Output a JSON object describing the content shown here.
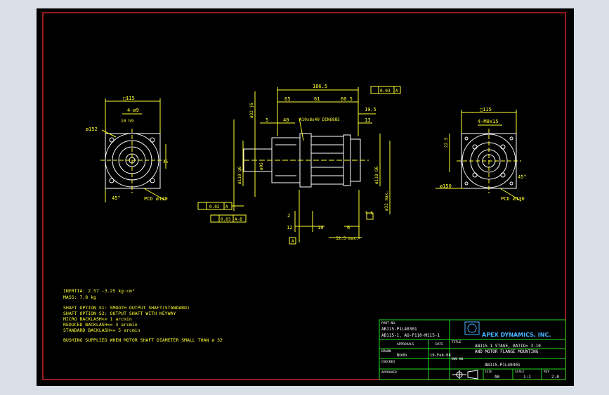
{
  "notes": {
    "inertia": "INERTIA:   2.57 -3.25 kg·cm²",
    "mass": "MASS: 7.8 kg",
    "shaft_s1": "SHAFT OPTION S1: SMOOTH OUTPUT SHAFT(STANDARD)",
    "shaft_s2": "SHAFT OPTION S2: OUTPUT SHAFT WITH KEYWAY",
    "micro": "MICRO BACKLASH<= 1 arcmin",
    "reduced": "REDUCED BACKLASH<= 3 arcmin",
    "standard": "STANDARD BACKLASH<= 5 arcmin",
    "bushing": "BUSHING SUPPLIED WHEN MOTOR SHAFT DIAMETER SMALL THAN ø 32"
  },
  "left_view": {
    "square": "□115",
    "holes": "4-ø9",
    "fit": "10 h9",
    "pcd": "PCD ø130",
    "dia": "ø152",
    "angle": "45°",
    "d35": "35"
  },
  "center_view": {
    "overall": "186.5",
    "d65": "65",
    "d61": "61",
    "d60_5": "60.5",
    "d19_5": "19.5",
    "d5": "5",
    "d40": "40",
    "d13": "13",
    "key": "A10x8x40 DIN6885",
    "runout_top": "0.03",
    "datum_a": "A",
    "perp": "0.02",
    "runout_bottom": "0.03",
    "datum_ab": "A-B",
    "d2": "2",
    "d12": "12",
    "d10": "10",
    "d6": "6",
    "d5_5": "5.5",
    "d32_5": "32.5 max.",
    "dia_shaft": "ø32 j6",
    "dia_main": "ø110 g6",
    "dia_motor": "ø110 G6",
    "dia_max": "ø32 max.",
    "dia_95": "ø95"
  },
  "right_view": {
    "square": "□115",
    "holes": "4-M8x15",
    "pcd": "PCD ø130",
    "dia": "ø150",
    "d45": "45°",
    "d25": "22.5"
  },
  "title_block": {
    "part_no_label": "PART NO.",
    "part_no_1": "AB115-P1L40301",
    "part_no_2": "AB115-1, AO-P110-M115-1",
    "approvals_label": "APPROVALS",
    "date_label": "DATE",
    "drawn_label": "DRAWN",
    "drawn_by": "Nodo",
    "drawn_date": "19-Feb-08",
    "checked_label": "CHECKED",
    "approved_label": "APPROVED",
    "company": "APEX DYNAMICS, INC.",
    "title_label": "TITLE",
    "title_1": "AB115 1 STAGE, RATIO= 3-10",
    "title_2": "AND MOTOR FLANGE MOUNTING",
    "dwg_label": "DWG NO.",
    "dwg_no": "AB115-P1L40301",
    "size_label": "SIZE",
    "size": "A0",
    "scale_label": "SCALE",
    "scale": "1:1",
    "rev_label": "REV",
    "rev": "2.0"
  }
}
